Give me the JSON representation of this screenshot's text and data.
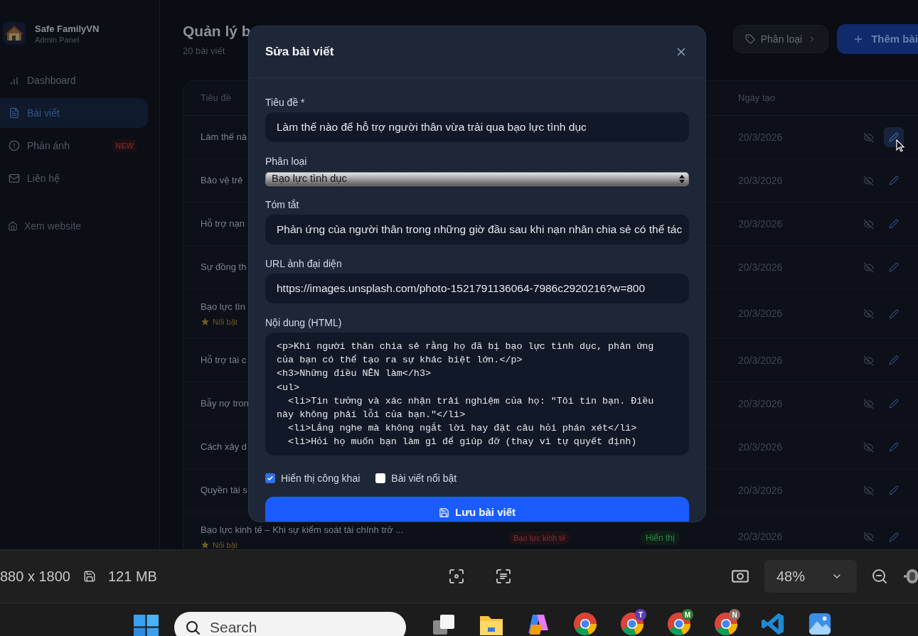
{
  "sidebar": {
    "brand": "Safe FamilyVN",
    "subtitle": "Admin Panel",
    "items": [
      {
        "label": "Dashboard",
        "selected": false
      },
      {
        "label": "Bài viết",
        "selected": true
      },
      {
        "label": "Phản ánh",
        "selected": false,
        "badge": "NEW"
      },
      {
        "label": "Liên hệ",
        "selected": false
      }
    ],
    "footer_link": "Xem website"
  },
  "header": {
    "title": "Quản lý b",
    "count": "20 bài viết",
    "buttons": [
      {
        "label": "Phân loại",
        "kind": "secondary"
      },
      {
        "label": "Thêm bài",
        "kind": "primary"
      }
    ]
  },
  "table": {
    "columns": [
      "Tiêu đề",
      "Ngày tạo"
    ],
    "rows": [
      {
        "title": "Làm thế nà",
        "date": "20/3/2026",
        "hovered": true
      },
      {
        "title": "Bảo vệ trẻ",
        "date": "20/3/2026",
        "hovered": false
      },
      {
        "title": "Hỗ trợ nạn",
        "date": "20/3/2026",
        "hovered": false
      },
      {
        "title": "Sự đồng th",
        "date": "20/3/2026",
        "hovered": false
      },
      {
        "title": "Bạo lực tìn",
        "tag": "Nổi bật",
        "date": "20/3/2026",
        "hovered": false
      },
      {
        "title": "Hỗ trợ tài c",
        "date": "20/3/2026",
        "hovered": false
      },
      {
        "title": "Bẫy nợ tron",
        "date": "20/3/2026",
        "hovered": false
      },
      {
        "title": "Cách xây d",
        "date": "20/3/2026",
        "hovered": false
      },
      {
        "title": "Quyền tài s",
        "date": "20/3/2026",
        "hovered": false
      },
      {
        "title": "Bạo lực kinh tế – Khi sự kiểm soát tài chính trở ...",
        "tag": "Nổi bật",
        "category": "Bạo lực kinh tế",
        "status": "Hiển thị",
        "date": "20/3/2026",
        "hovered": false
      }
    ]
  },
  "modal": {
    "title": "Sửa bài viết",
    "fields": [
      {
        "label": "Tiêu đề *",
        "kind": "input",
        "value": "Làm thế nào để hỗ trợ người thân vừa trải qua bạo lực tình dục"
      },
      {
        "label": "Phân loại",
        "kind": "select",
        "value": "Bạo lực tình dục"
      },
      {
        "label": "Tóm tắt",
        "kind": "input",
        "value": "Phản ứng của người thân trong những giờ đầu sau khi nạn nhân chia sẻ có thể tác"
      },
      {
        "label": "URL ảnh đại diện",
        "kind": "input",
        "value": "https://images.unsplash.com/photo-1521791136064-7986c2920216?w=800"
      },
      {
        "label": "Nội dung (HTML)",
        "kind": "code",
        "lines": [
          "<p>Khi người thân chia sẻ rằng họ đã bị bạo lực tình dục, phản ứng",
          "của bạn có thể tạo ra sự khác biệt lớn.</p>",
          "<h3>Những điều NÊN làm</h3>",
          "<ul>",
          "  <li>Tin tưởng và xác nhận trải nghiệm của họ: \"Tôi tin bạn. Điều",
          "này không phải lỗi của bạn.\"</li>",
          "  <li>Lắng nghe mà không ngắt lời hay đặt câu hỏi phán xét</li>",
          "  <li>Hỏi họ muốn bạn làm gì để giúp đỡ (thay vì tự quyết định)"
        ]
      }
    ],
    "checkboxes": [
      {
        "label": "Hiển thị công khai",
        "checked": true
      },
      {
        "label": "Bài viết nổi bật",
        "checked": false
      }
    ],
    "submit": "Lưu bài viết"
  },
  "viewer_bar": {
    "dimensions": "880 x 1800",
    "size": "121 MB",
    "zoom": "48%"
  },
  "taskbar": {
    "search_placeholder": "Search",
    "profile_badges": [
      {
        "letter": "T",
        "color": "#5b3fb5"
      },
      {
        "letter": "M",
        "color": "#2e7d32"
      },
      {
        "letter": "N",
        "color": "#8d6e63"
      }
    ]
  }
}
